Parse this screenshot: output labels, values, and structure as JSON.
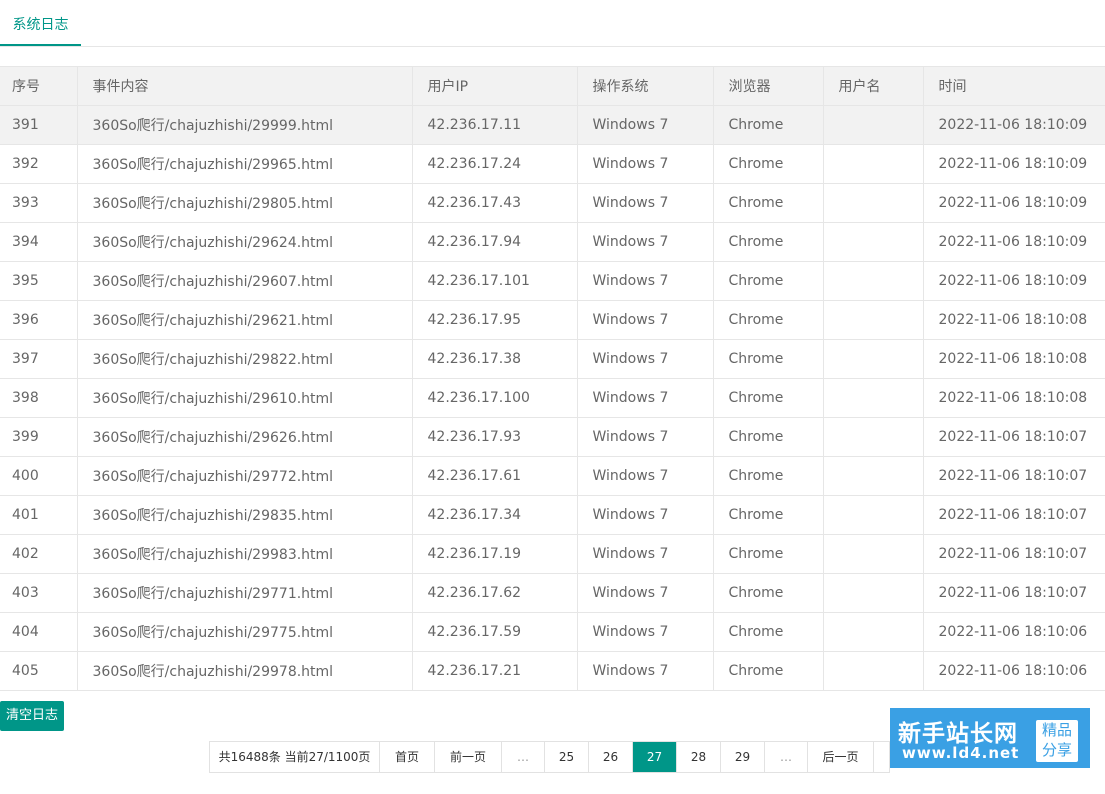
{
  "tab": {
    "label": "系统日志"
  },
  "table": {
    "headers": [
      "序号",
      "事件内容",
      "用户IP",
      "操作系统",
      "浏览器",
      "用户名",
      "时间"
    ],
    "rows": [
      [
        "391",
        "360So爬行/chajuzhishi/29999.html",
        "42.236.17.11",
        "Windows 7",
        "Chrome",
        "",
        "2022-11-06 18:10:09"
      ],
      [
        "392",
        "360So爬行/chajuzhishi/29965.html",
        "42.236.17.24",
        "Windows 7",
        "Chrome",
        "",
        "2022-11-06 18:10:09"
      ],
      [
        "393",
        "360So爬行/chajuzhishi/29805.html",
        "42.236.17.43",
        "Windows 7",
        "Chrome",
        "",
        "2022-11-06 18:10:09"
      ],
      [
        "394",
        "360So爬行/chajuzhishi/29624.html",
        "42.236.17.94",
        "Windows 7",
        "Chrome",
        "",
        "2022-11-06 18:10:09"
      ],
      [
        "395",
        "360So爬行/chajuzhishi/29607.html",
        "42.236.17.101",
        "Windows 7",
        "Chrome",
        "",
        "2022-11-06 18:10:09"
      ],
      [
        "396",
        "360So爬行/chajuzhishi/29621.html",
        "42.236.17.95",
        "Windows 7",
        "Chrome",
        "",
        "2022-11-06 18:10:08"
      ],
      [
        "397",
        "360So爬行/chajuzhishi/29822.html",
        "42.236.17.38",
        "Windows 7",
        "Chrome",
        "",
        "2022-11-06 18:10:08"
      ],
      [
        "398",
        "360So爬行/chajuzhishi/29610.html",
        "42.236.17.100",
        "Windows 7",
        "Chrome",
        "",
        "2022-11-06 18:10:08"
      ],
      [
        "399",
        "360So爬行/chajuzhishi/29626.html",
        "42.236.17.93",
        "Windows 7",
        "Chrome",
        "",
        "2022-11-06 18:10:07"
      ],
      [
        "400",
        "360So爬行/chajuzhishi/29772.html",
        "42.236.17.61",
        "Windows 7",
        "Chrome",
        "",
        "2022-11-06 18:10:07"
      ],
      [
        "401",
        "360So爬行/chajuzhishi/29835.html",
        "42.236.17.34",
        "Windows 7",
        "Chrome",
        "",
        "2022-11-06 18:10:07"
      ],
      [
        "402",
        "360So爬行/chajuzhishi/29983.html",
        "42.236.17.19",
        "Windows 7",
        "Chrome",
        "",
        "2022-11-06 18:10:07"
      ],
      [
        "403",
        "360So爬行/chajuzhishi/29771.html",
        "42.236.17.62",
        "Windows 7",
        "Chrome",
        "",
        "2022-11-06 18:10:07"
      ],
      [
        "404",
        "360So爬行/chajuzhishi/29775.html",
        "42.236.17.59",
        "Windows 7",
        "Chrome",
        "",
        "2022-11-06 18:10:06"
      ],
      [
        "405",
        "360So爬行/chajuzhishi/29978.html",
        "42.236.17.21",
        "Windows 7",
        "Chrome",
        "",
        "2022-11-06 18:10:06"
      ]
    ]
  },
  "actions": {
    "clear_label": "清空日志"
  },
  "pagination": {
    "info": "共16488条 当前27/1100页",
    "first": "首页",
    "prev": "前一页",
    "ellipsis": "…",
    "pages": [
      "25",
      "26",
      "27",
      "28",
      "29"
    ],
    "current": "27",
    "next": "后一页"
  },
  "watermark": {
    "title": "新手站长网",
    "url": "www.ld4.net",
    "badge_line1": "精品",
    "badge_line2": "分享"
  },
  "colors": {
    "accent": "#009688",
    "watermark": "#3aa0e4"
  }
}
